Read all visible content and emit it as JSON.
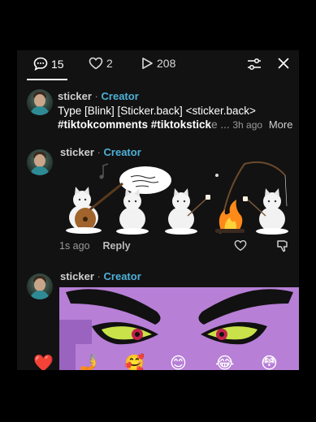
{
  "topbar": {
    "comments_count": "15",
    "likes_count": "2",
    "shares_count": "208"
  },
  "comment1": {
    "user": "sticker",
    "separator": "·",
    "badge": "Creator",
    "line1": "Type [Blink] [Sticker.back] <sticker.back>",
    "line2_tags": "#tiktokcomments #tiktokstick",
    "line2_fade": "e ...",
    "time": "3h ago",
    "more": "More"
  },
  "comment2": {
    "user": "sticker",
    "separator": "·",
    "badge": "Creator",
    "time": "1s ago",
    "reply": "Reply"
  },
  "comment3": {
    "user": "sticker",
    "separator": "·",
    "badge": "Creator"
  },
  "emoji_bar": [
    "❤️",
    "🤳",
    "🥰",
    "😊",
    "😂",
    "😳"
  ],
  "colors": {
    "background": "#121212",
    "creator_badge": "#4fb0d8",
    "purple_sticker": "#b77fd6"
  }
}
